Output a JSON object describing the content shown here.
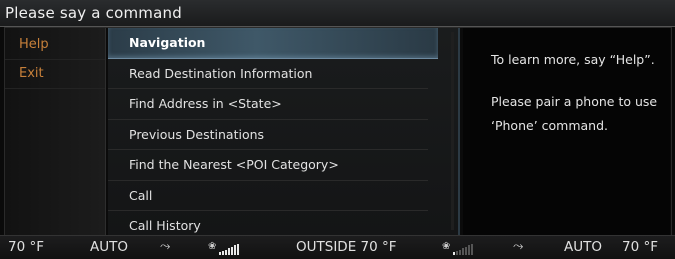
{
  "header": {
    "title": "Please say a command"
  },
  "sidebar": {
    "items": [
      {
        "label": "Help"
      },
      {
        "label": "Exit"
      }
    ]
  },
  "menu": {
    "items": [
      {
        "label": "Navigation",
        "selected": true
      },
      {
        "label": "Read Destination Information"
      },
      {
        "label": "Find Address in <State>"
      },
      {
        "label": "Previous Destinations"
      },
      {
        "label": "Find the Nearest <POI Category>"
      },
      {
        "label": "Call"
      },
      {
        "label": "Call History"
      }
    ]
  },
  "info": {
    "line1": "To learn more, say “Help”.",
    "line2": "Please pair a phone to use ‘Phone’ command."
  },
  "climate": {
    "left_temp": "70 °F",
    "left_mode": "AUTO",
    "outside": "OUTSIDE 70 °F",
    "right_mode": "AUTO",
    "right_temp": "70 °F",
    "left_fan_level": 1.0,
    "right_fan_level": 0.2
  },
  "icons": [
    "seat-heat-icon",
    "fan-icon"
  ]
}
